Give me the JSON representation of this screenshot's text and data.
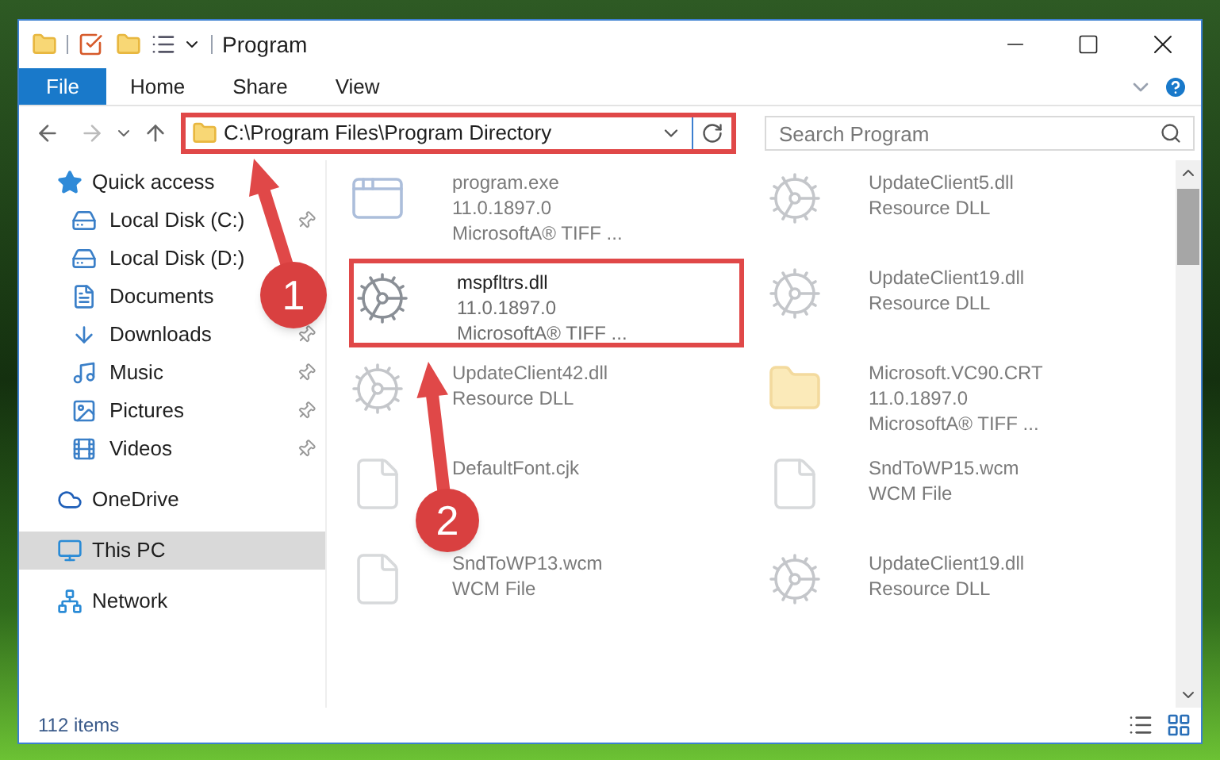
{
  "window": {
    "title": "Program"
  },
  "ribbon_tabs": [
    {
      "label": "File",
      "selected": true
    },
    {
      "label": "Home",
      "selected": false
    },
    {
      "label": "Share",
      "selected": false
    },
    {
      "label": "View",
      "selected": false
    }
  ],
  "address_bar": {
    "path": "C:\\Program Files\\Program Directory",
    "highlighted": true
  },
  "search": {
    "placeholder": "Search Program"
  },
  "sidebar": {
    "items": [
      {
        "label": "Quick access",
        "selected": false,
        "children": [
          {
            "label": "Local Disk (C:)",
            "selected": false,
            "pinned": true
          },
          {
            "label": "Local Disk (D:)",
            "selected": false,
            "pinned": false
          },
          {
            "label": "Documents",
            "selected": false,
            "pinned": false
          },
          {
            "label": "Downloads",
            "selected": false,
            "pinned": true
          },
          {
            "label": "Music",
            "selected": false,
            "pinned": true
          },
          {
            "label": "Pictures",
            "selected": false,
            "pinned": true
          },
          {
            "label": "Videos",
            "selected": false,
            "pinned": true
          }
        ]
      },
      {
        "label": "OneDrive",
        "selected": false
      },
      {
        "label": "This PC",
        "selected": true
      },
      {
        "label": "Network",
        "selected": false
      }
    ]
  },
  "files": [
    {
      "kind": "exe",
      "lines": [
        "program.exe",
        "11.0.1897.0",
        "MicrosoftA® TIFF ..."
      ],
      "blurred": true,
      "highlighted": false
    },
    {
      "kind": "dll",
      "lines": [
        "UpdateClient5.dll",
        "Resource DLL"
      ],
      "blurred": true,
      "highlighted": false
    },
    {
      "kind": "dll",
      "lines": [
        "mspfltrs.dll",
        "11.0.1897.0",
        "MicrosoftA® TIFF ..."
      ],
      "blurred": false,
      "highlighted": true
    },
    {
      "kind": "dll",
      "lines": [
        "UpdateClient19.dll",
        "Resource DLL"
      ],
      "blurred": true,
      "highlighted": false
    },
    {
      "kind": "dll",
      "lines": [
        "UpdateClient42.dll",
        "Resource DLL"
      ],
      "blurred": true,
      "highlighted": false
    },
    {
      "kind": "folder",
      "lines": [
        "Microsoft.VC90.CRT",
        "11.0.1897.0",
        "MicrosoftA® TIFF ..."
      ],
      "blurred": true,
      "highlighted": false
    },
    {
      "kind": "file",
      "lines": [
        "DefaultFont.cjk"
      ],
      "blurred": true,
      "highlighted": false
    },
    {
      "kind": "file",
      "lines": [
        "SndToWP15.wcm",
        "WCM File"
      ],
      "blurred": true,
      "highlighted": false
    },
    {
      "kind": "file",
      "lines": [
        "SndToWP13.wcm",
        "WCM File"
      ],
      "blurred": true,
      "highlighted": false
    },
    {
      "kind": "dll",
      "lines": [
        "UpdateClient19.dll",
        "Resource DLL"
      ],
      "blurred": true,
      "highlighted": false
    }
  ],
  "status_bar": {
    "item_count": "112 items"
  },
  "annotations": [
    {
      "number": "1"
    },
    {
      "number": "2"
    }
  ]
}
